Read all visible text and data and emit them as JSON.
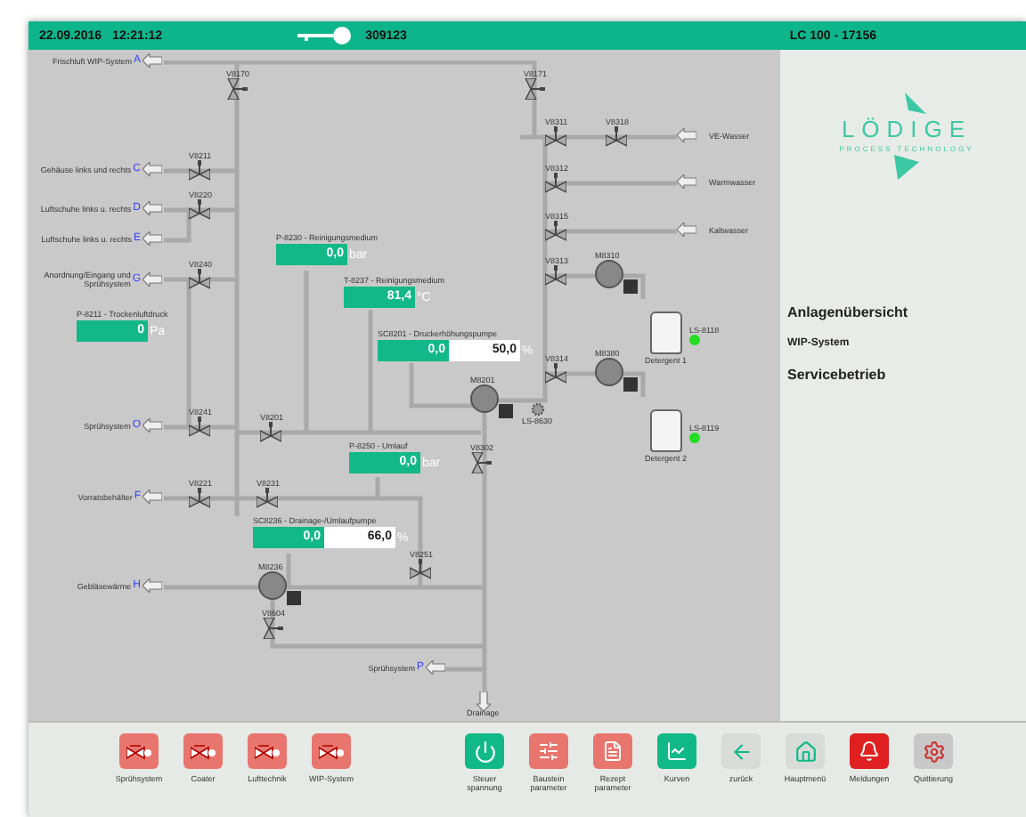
{
  "header": {
    "date": "22.09.2016",
    "time": "12:21:12",
    "user": "309123",
    "machine": "LC 100 - 17156"
  },
  "diagram": {
    "inlets": [
      {
        "label": "Frischluft WIP-System",
        "letter": "A"
      },
      {
        "label": "Gehäuse links und rechts",
        "letter": "C"
      },
      {
        "label": "Luftschuhe links u. rechts",
        "letter": "D"
      },
      {
        "label": "Luftschuhe links u. rechts",
        "letter": "E"
      },
      {
        "label": "Anordnung/Eingang und Sprühsystem",
        "letter": "G"
      },
      {
        "label": "Sprühsystem",
        "letter": "O"
      },
      {
        "label": "Vorratsbehälter",
        "letter": "F"
      },
      {
        "label": "Gebläsewärme",
        "letter": "H"
      },
      {
        "label": "Sprühsystem",
        "letter": "P"
      }
    ],
    "water_inlets": [
      "VE-Wasser",
      "Warmwasser",
      "Kaltwasser"
    ],
    "valves": [
      "V8170",
      "V8171",
      "V8211",
      "V8220",
      "V8240",
      "V8241",
      "V8221",
      "V8231",
      "V8201",
      "V8311",
      "V8318",
      "V8312",
      "V8315",
      "V8313",
      "V8314",
      "V8302",
      "V8251",
      "V8604"
    ],
    "pumps": [
      "M8310",
      "M8380",
      "M8201",
      "M8236"
    ],
    "measurements": [
      {
        "title": "P-8230 - Reinigungsmedium",
        "value": "0,0",
        "unit": "bar"
      },
      {
        "title": "T-8237 - Reinigungsmedium",
        "value": "81,4",
        "unit": "°C"
      },
      {
        "title": "P-8211 - Trockenluftdruck",
        "value": "0",
        "unit": "Pa"
      },
      {
        "title": "SC8201 - Druckerhöhungspumpe",
        "value": "0,0",
        "setpoint": "50,0",
        "unit": "%"
      },
      {
        "title": "P-8250 - Umlauf",
        "value": "0,0",
        "unit": "bar"
      },
      {
        "title": "SC8236 - Drainage-/Umlaufpumpe",
        "value": "0,0",
        "setpoint": "66,0",
        "unit": "%"
      }
    ],
    "tanks": [
      {
        "label": "Detergent 1",
        "sensor": "LS-8118",
        "ok": true
      },
      {
        "label": "Detergent 2",
        "sensor": "LS-8119",
        "ok": true
      }
    ],
    "level_sensor": "LS-8630",
    "outlet": "Drainage"
  },
  "side_panel": {
    "logo": "LÖDIGE",
    "logo_sub": "PROCESS TECHNOLOGY",
    "lines": [
      {
        "text": "Anlagenübersicht",
        "kind": "title"
      },
      {
        "text": "WIP-System",
        "kind": "small"
      },
      {
        "text": "Servicebetrieb",
        "kind": "title"
      }
    ]
  },
  "toolbar": [
    {
      "kind": "valve",
      "lines": [
        "Sprühsystem"
      ]
    },
    {
      "kind": "valve",
      "lines": [
        "Coater"
      ]
    },
    {
      "kind": "valve",
      "lines": [
        "Lufttechnik"
      ]
    },
    {
      "kind": "valve",
      "lines": [
        "WIP-System"
      ]
    },
    {
      "kind": "power",
      "lines": [
        "Steuer",
        "spannung"
      ]
    },
    {
      "kind": "blocks",
      "lines": [
        "Baustein",
        "parameter"
      ]
    },
    {
      "kind": "recipe",
      "lines": [
        "Rezept",
        "parameter"
      ]
    },
    {
      "kind": "curves",
      "lines": [
        "Kurven"
      ]
    },
    {
      "kind": "back",
      "lines": [
        "zurück"
      ]
    },
    {
      "kind": "home",
      "lines": [
        "Hauptmenü"
      ]
    },
    {
      "kind": "alarm",
      "lines": [
        "Meldungen"
      ]
    },
    {
      "kind": "ack",
      "lines": [
        "Quittierung"
      ]
    }
  ]
}
